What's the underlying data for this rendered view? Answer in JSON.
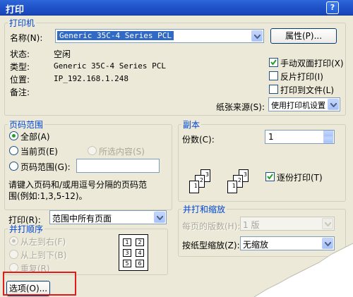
{
  "window": {
    "title": "打印",
    "help_btn": "?",
    "close_btn": "×"
  },
  "printer": {
    "legend": "打印机",
    "name_label": "名称(N):",
    "name_value": "Generic 35C-4 Series PCL",
    "properties_btn": "属性(P)...",
    "status_label": "状态:",
    "status_value": "空闲",
    "type_label": "类型:",
    "type_value": "Generic 35C-4 Series PCL",
    "where_label": "位置:",
    "where_value": "IP_192.168.1.248",
    "comment_label": "备注:",
    "manual_duplex": {
      "label": "手动双面打印(X)",
      "checked": true
    },
    "reverse": {
      "label": "反片打印(I)",
      "checked": false
    },
    "to_file": {
      "label": "打印到文件(L)",
      "checked": false
    },
    "paper_source_label": "纸张来源(S):",
    "paper_source_value": "使用打印机设置"
  },
  "page_range": {
    "legend": "页码范围",
    "all": "全部(A)",
    "current": "当前页(E)",
    "selection": "所选内容(S)",
    "pages": "页码范围(G):",
    "hint_line1": "请键入页码和/或用逗号分隔的页码范",
    "hint_line2": "围(例如:1,3,5-12)。"
  },
  "copies": {
    "legend": "副本",
    "count_label": "份数(C):",
    "count_value": "1",
    "collate": {
      "label": "逐份打印(T)",
      "checked": true
    },
    "stack1": [
      "3",
      "2",
      "1"
    ],
    "stack2": [
      "3",
      "2",
      "1"
    ]
  },
  "print_what": {
    "label": "打印(R):",
    "value": "范围中所有页面"
  },
  "order": {
    "legend": "并打顺序",
    "ltr": "从左到右(F)",
    "ttb": "从上到下(B)",
    "repeat": "重复(R)",
    "grid": [
      "1",
      "2",
      "3",
      "4",
      "5",
      "6"
    ]
  },
  "zoom": {
    "legend": "并打和缩放",
    "pps_label": "每页的版数(H):",
    "pps_value": "1 版",
    "scale_label": "按纸型缩放(Z):",
    "scale_value": "无缩放"
  },
  "footer": {
    "options_btn": "选项(O)..."
  },
  "colors": {
    "highlight_box": "#e21a1a",
    "titlebar": "#1d4fc6",
    "legend": "#0046d5"
  }
}
